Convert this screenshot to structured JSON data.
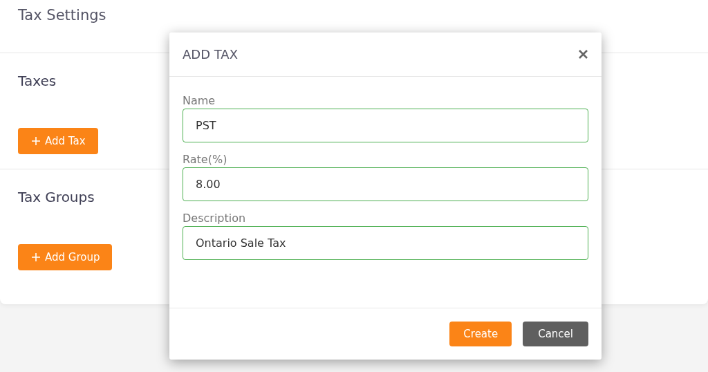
{
  "page": {
    "title": "Tax Settings"
  },
  "sections": [
    {
      "title": "Taxes",
      "button": "Add Tax"
    },
    {
      "title": "Tax Groups",
      "button": "Add Group"
    }
  ],
  "dialog": {
    "title": "ADD TAX",
    "fields": [
      {
        "label": "Name",
        "value": "PST"
      },
      {
        "label": "Rate(%)",
        "value": "8.00"
      },
      {
        "label": "Description",
        "value": "Ontario Sale Tax"
      }
    ],
    "buttons": [
      {
        "label": "Create",
        "kind": "primary"
      },
      {
        "label": "Cancel",
        "kind": "secondary"
      }
    ]
  }
}
